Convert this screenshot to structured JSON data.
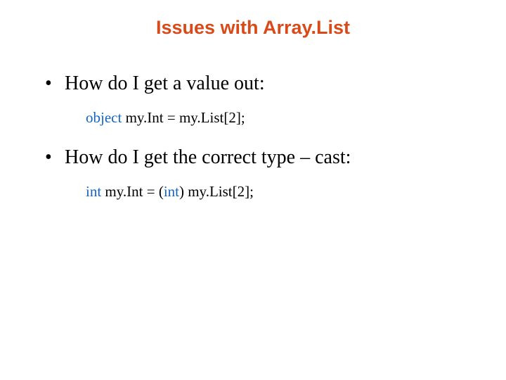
{
  "title": "Issues with Array.List",
  "bullets": [
    {
      "text": "How do I get a value out:",
      "code": {
        "kw1": "object",
        "rest1": " my.Int = my.List[2];",
        "kw2": "",
        "rest2": ""
      }
    },
    {
      "text": "How do I get the correct type – cast:",
      "code": {
        "kw1": "int",
        "rest1": " my.Int = (",
        "kw2": "int",
        "rest2": ") my.List[2];"
      }
    }
  ]
}
